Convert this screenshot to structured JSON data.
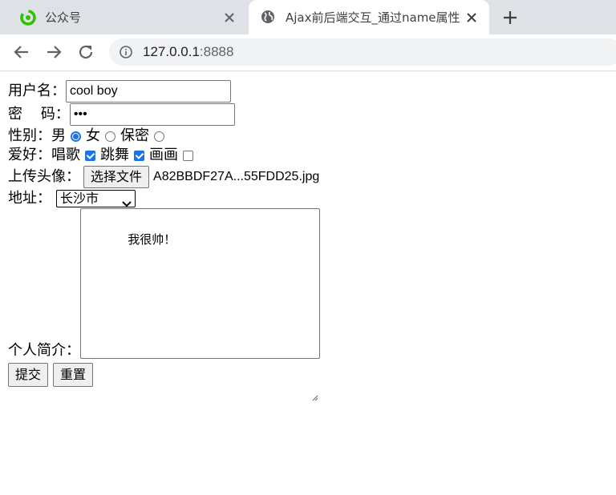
{
  "browser": {
    "tabs": [
      {
        "title": "公众号",
        "active": false
      },
      {
        "title": "Ajax前后端交互_通过name属性",
        "active": true
      }
    ],
    "url_host": "127.0.0.1",
    "url_port": ":8888"
  },
  "form": {
    "username": {
      "label": "用户名：",
      "value": "cool boy"
    },
    "password": {
      "label": "密    码：",
      "value": "•••"
    },
    "gender": {
      "label": "性别：",
      "options": [
        "男",
        "女",
        "保密"
      ],
      "selected": "男"
    },
    "hobbies": {
      "label": "爱好：",
      "options": [
        "唱歌",
        "跳舞",
        "画画"
      ],
      "checked": [
        "唱歌",
        "跳舞"
      ]
    },
    "avatar": {
      "label": "上传头像：",
      "button": "选择文件",
      "file_name": "A82BBDF27A...55FDD25.jpg"
    },
    "address": {
      "label": "地址：",
      "selected": "长沙市"
    },
    "bio": {
      "label": "个人简介：",
      "value": "我很帅！"
    },
    "submit_label": "提交",
    "reset_label": "重置"
  },
  "colors": {
    "accent": "#1a73e8",
    "tabstrip": "#dee1e6",
    "omnibox": "#f1f3f4"
  }
}
